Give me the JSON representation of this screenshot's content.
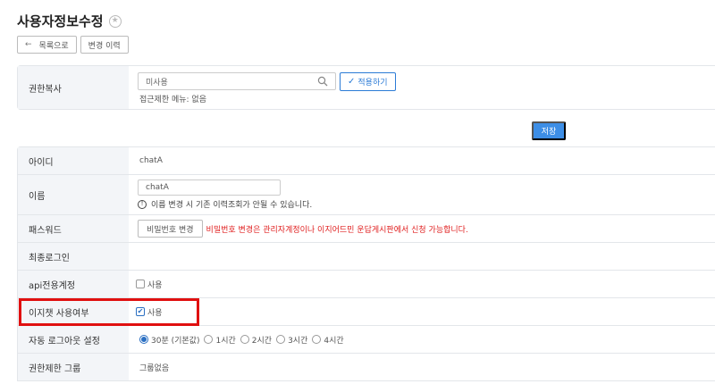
{
  "page": {
    "title": "사용자정보수정",
    "favorite_icon": "star-icon"
  },
  "top_buttons": {
    "back_label": "목록으로",
    "history_label": "변경 이력"
  },
  "permission_copy": {
    "label": "권한복사",
    "search_value": "미사용",
    "apply_label": "적용하기",
    "note": "접근제한 메뉴: 없음"
  },
  "save_label": "저장",
  "fields": {
    "id": {
      "label": "아이디",
      "value": "chatA"
    },
    "name": {
      "label": "이름",
      "value": "chatA",
      "note": "이름 변경 시 기존 이력조회가 안될 수 있습니다."
    },
    "password": {
      "label": "패스워드",
      "button": "비밀번호 변경",
      "warning": "비밀번호 변경은 관리자계정이나 이지어드민 운답게시판에서 신청 가능합니다."
    },
    "last_login": {
      "label": "최종로그인",
      "value": ""
    },
    "api_account": {
      "label": "api전용계정",
      "option": "사용",
      "checked": false
    },
    "easychat": {
      "label": "이지챗 사용여부",
      "option": "사용",
      "checked": true
    },
    "auto_logout": {
      "label": "자동 로그아웃 설정",
      "options": [
        "30분 (기본값)",
        "1시간",
        "2시간",
        "3시간",
        "4시간"
      ],
      "selected": "30분 (기본값)"
    },
    "restrict_group": {
      "label": "권한제한 그룹",
      "value": "그룹없음"
    }
  },
  "colors": {
    "accent": "#3d8ee6",
    "warning": "#e02020",
    "highlight": "#e01010"
  }
}
